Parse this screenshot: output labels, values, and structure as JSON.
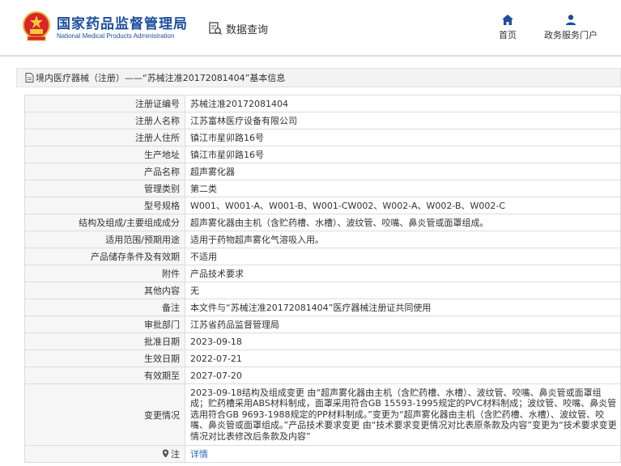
{
  "header": {
    "site_title": "国家药品监督管理局",
    "site_subtitle": "National Medical Products Administration",
    "query_label": "数据查询",
    "nav": {
      "home_label": "首页",
      "portal_label": "政务服务门户"
    }
  },
  "breadcrumb": {
    "text": "境内医疗器械（注册）——“苏械注准20172081404”基本信息"
  },
  "details": [
    {
      "label": "注册证编号",
      "value": "苏械注准20172081404"
    },
    {
      "label": "注册人名称",
      "value": "江苏富林医疗设备有限公司"
    },
    {
      "label": "注册人住所",
      "value": "镇江市星卯路16号"
    },
    {
      "label": "生产地址",
      "value": "镇江市星卯路16号"
    },
    {
      "label": "产品名称",
      "value": "超声雾化器"
    },
    {
      "label": "管理类别",
      "value": "第二类"
    },
    {
      "label": "型号规格",
      "value": "W001、W001-A、W001-B、W001-CW002、W002-A、W002-B、W002-C"
    },
    {
      "label": "结构及组成/主要组成成分",
      "value": "超声雾化器由主机（含贮药槽、水槽）、波纹管、咬嘴、鼻炎管或面罩组成。"
    },
    {
      "label": "适用范围/预期用途",
      "value": "适用于药物超声雾化气溶吸入用。"
    },
    {
      "label": "产品储存条件及有效期",
      "value": "不适用"
    },
    {
      "label": "附件",
      "value": "产品技术要求"
    },
    {
      "label": "其他内容",
      "value": "无"
    },
    {
      "label": "备注",
      "value": "本文件与“苏械注准20172081404”医疗器械注册证共同使用"
    },
    {
      "label": "审批部门",
      "value": "江苏省药品监督管理局"
    },
    {
      "label": "批准日期",
      "value": "2023-09-18"
    },
    {
      "label": "生效日期",
      "value": "2022-07-21"
    },
    {
      "label": "有效期至",
      "value": "2027-07-20"
    },
    {
      "label": "变更情况",
      "value": "2023-09-18结构及组成变更 由“超声雾化器由主机（含贮药槽、水槽）、波纹管、咬嘴、鼻炎管或面罩组成；贮药槽采用ABS材料制成，面罩采用符合GB 15593-1995规定的PVC材料制成；波纹管、咬嘴、鼻炎管选用符合GB 9693-1988规定的PP材料制成。”变更为“超声雾化器由主机（含贮药槽、水槽）、波纹管、咬嘴、鼻炎管或面罩组成。”产品技术要求变更 由“技术要求变更情况对比表原条款及内容”变更为“技术要求变更情况对比表修改后条款及内容”"
    },
    {
      "label": "注",
      "value": "详情"
    }
  ],
  "colors": {
    "brand_blue": "#1d4e9e",
    "link_blue": "#2a6ab3",
    "label_bg": "#f6f6f6"
  }
}
